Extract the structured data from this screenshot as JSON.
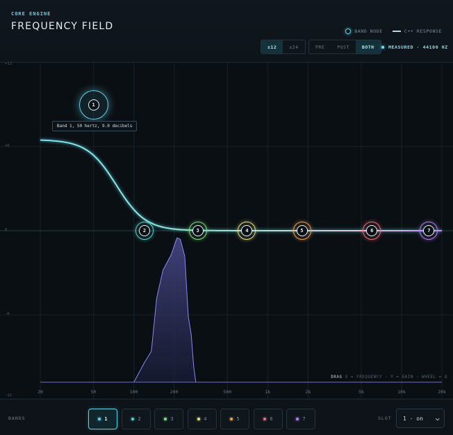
{
  "header": {
    "eyebrow": "CORE ENGINE",
    "title": "FREQUENCY FIELD",
    "legend": {
      "node_label": "BAND NODE",
      "line_label": "C++ RESPONSE"
    },
    "range_options": [
      "±12",
      "±24"
    ],
    "range_selected": "±12",
    "mode_options": [
      "PRE",
      "POST",
      "BOTH"
    ],
    "mode_selected": "BOTH",
    "measured": "MEASURED · 44100 HZ"
  },
  "plot": {
    "y_ticks": [
      "+12",
      "+6",
      "0",
      "-6",
      "-12"
    ],
    "x_ticks": [
      "20",
      "50",
      "100",
      "200",
      "500",
      "1k",
      "2k",
      "5k",
      "10k",
      "20k"
    ],
    "tooltip": "Band 1, 50 hertz, 9.0 decibels",
    "hint_prefix": "DRAG",
    "hint_text": "X = FREQUENCY · Y = GAIN · WHEEL = Q",
    "nodes": [
      {
        "band": "1",
        "freq_hz": 50,
        "gain_db": 9.0,
        "color": "#5fd3e6",
        "selected": true
      },
      {
        "band": "2",
        "freq_hz": 120,
        "gain_db": 0,
        "color": "#4fd1c5"
      },
      {
        "band": "3",
        "freq_hz": 300,
        "gain_db": 0,
        "color": "#7ee07a"
      },
      {
        "band": "4",
        "freq_hz": 700,
        "gain_db": 0,
        "color": "#e6e07a"
      },
      {
        "band": "5",
        "freq_hz": 1800,
        "gain_db": 0,
        "color": "#f0a04a"
      },
      {
        "band": "6",
        "freq_hz": 6000,
        "gain_db": 0,
        "color": "#f06a73"
      },
      {
        "band": "7",
        "freq_hz": 16000,
        "gain_db": 0,
        "color": "#b07cf0"
      }
    ]
  },
  "footer": {
    "bands_label": "BANDS",
    "bands": [
      {
        "label": "1",
        "color": "#5fd3e6",
        "active": true
      },
      {
        "label": "2",
        "color": "#4fd1c5"
      },
      {
        "label": "3",
        "color": "#7ee07a"
      },
      {
        "label": "4",
        "color": "#e6e07a"
      },
      {
        "label": "5",
        "color": "#f0a04a"
      },
      {
        "label": "6",
        "color": "#f06a73"
      },
      {
        "label": "7",
        "color": "#b07cf0"
      }
    ],
    "slot_label": "SLOT",
    "slot_value": "1 · on"
  }
}
